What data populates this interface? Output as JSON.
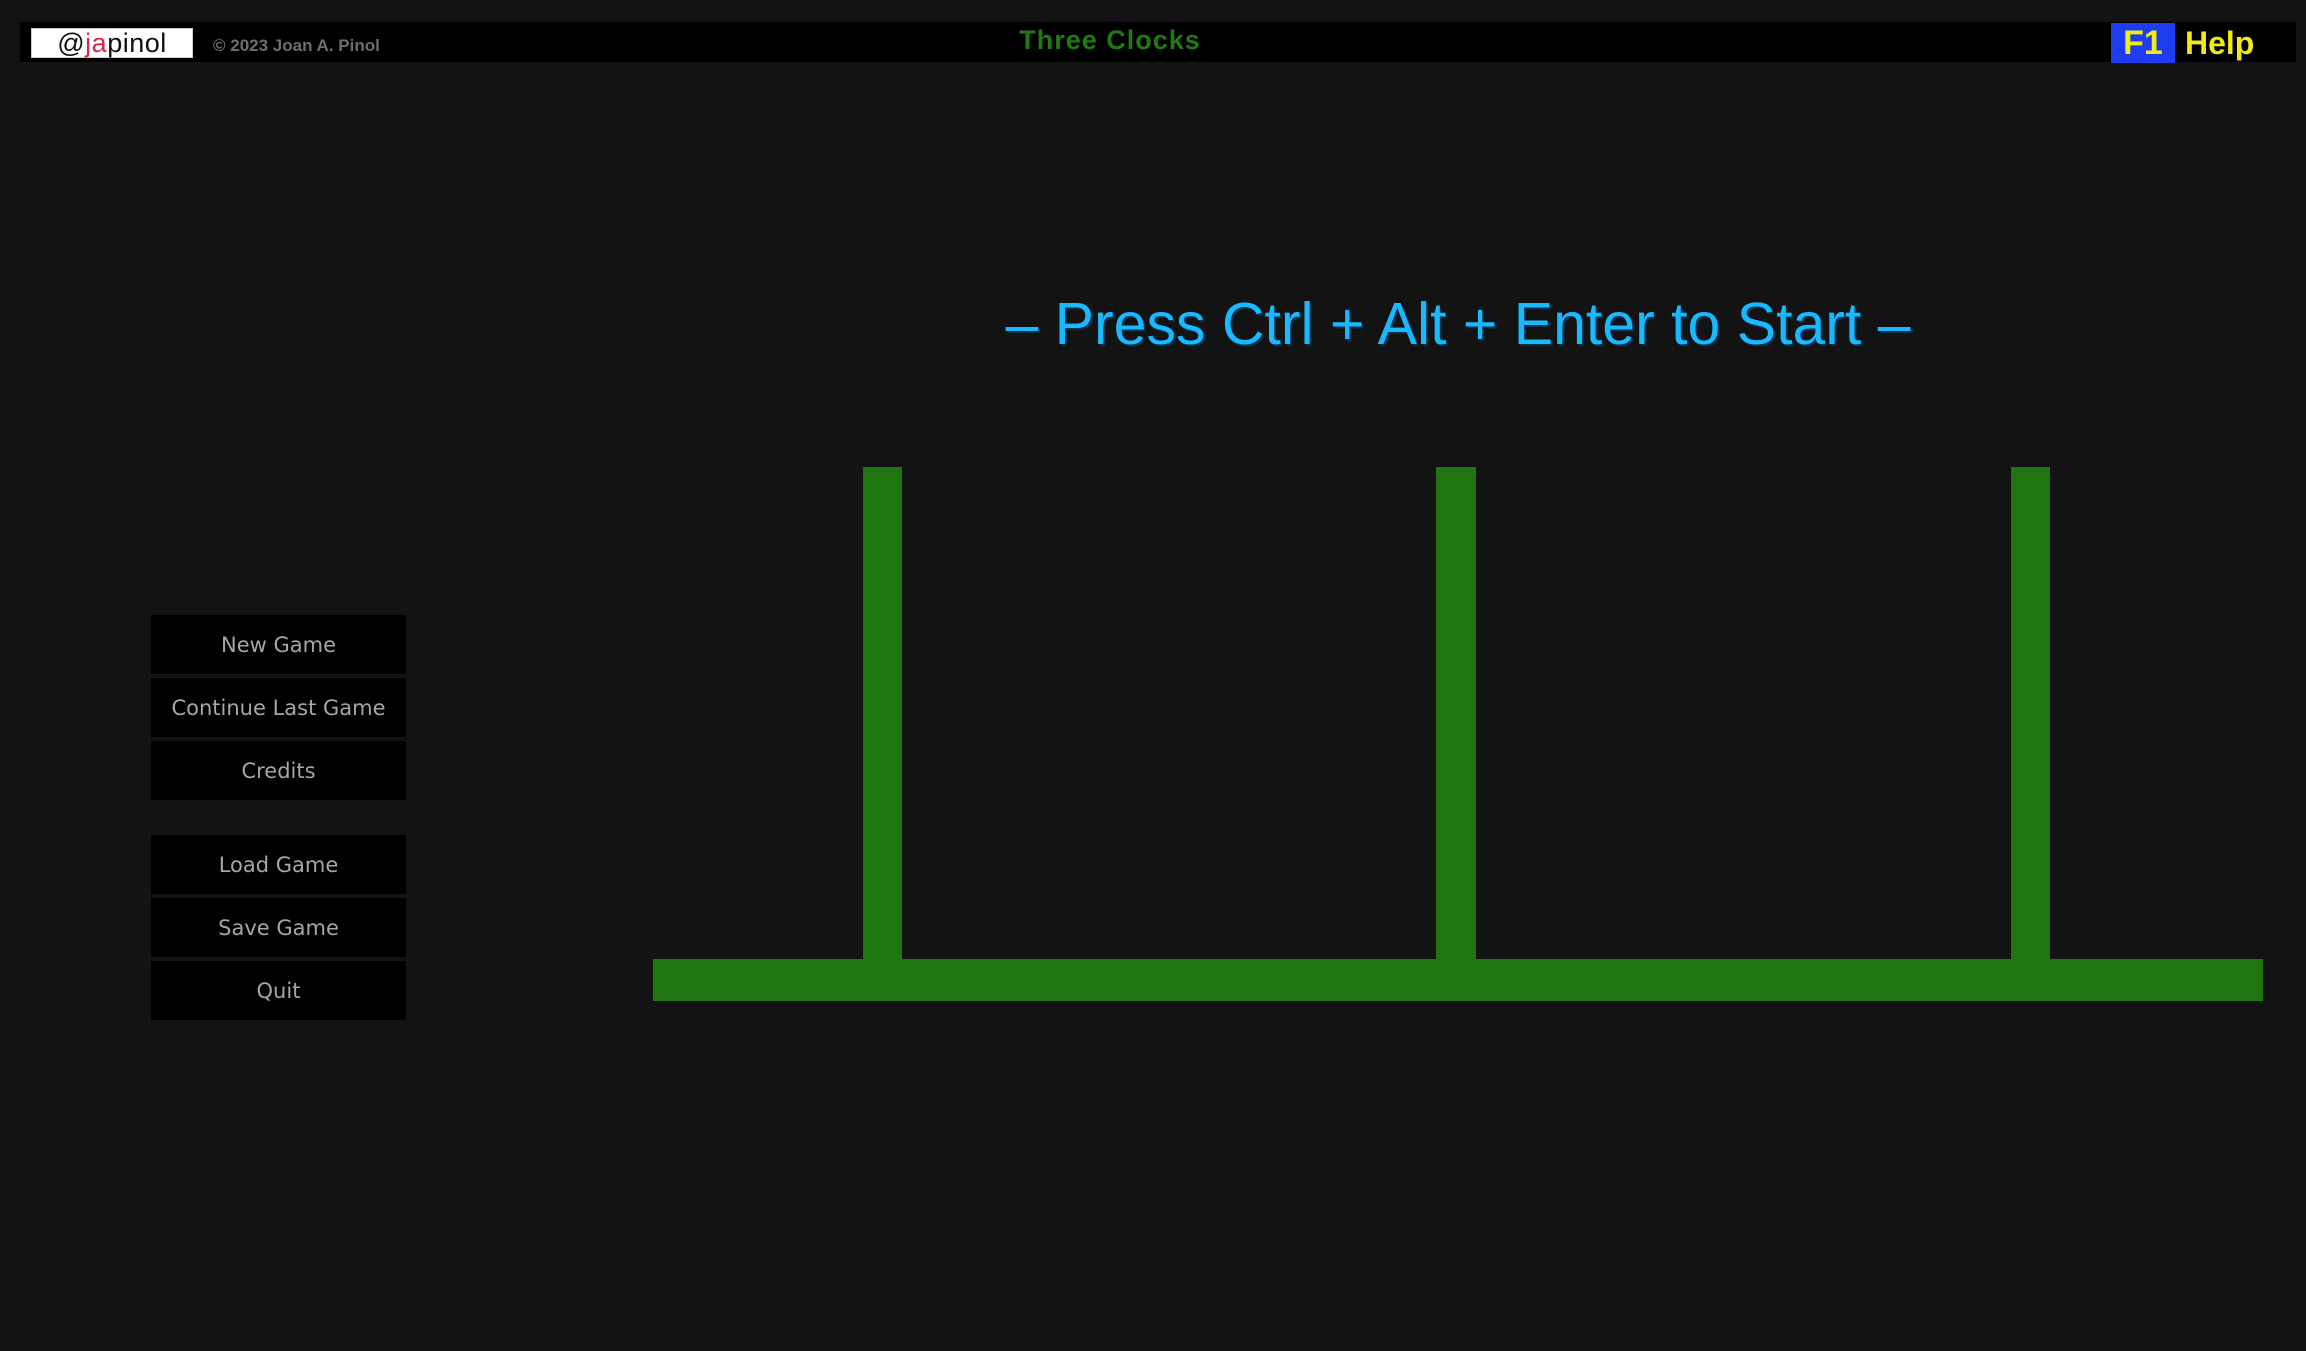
{
  "header": {
    "logo_prefix": "@",
    "logo_highlight": "ja",
    "logo_suffix": "pinol",
    "copyright": "© 2023 Joan A. Pinol",
    "title": "Three Clocks",
    "help_key": "F1",
    "help_label": "Help"
  },
  "prompt": "– Press Ctrl + Alt + Enter to Start –",
  "menu_primary": {
    "new_game": "New Game",
    "continue_last_game": "Continue Last Game",
    "credits": "Credits"
  },
  "menu_secondary": {
    "load_game": "Load Game",
    "save_game": "Save Game",
    "quit": "Quit"
  },
  "board": {
    "peg_count": 3,
    "color": "#1f7510",
    "icon": "tower-pegs-board"
  },
  "colors": {
    "background": "#131313",
    "title": "#1f7a12",
    "prompt": "#18b9ff",
    "help_key_bg": "#1e3cf0",
    "help_text": "#f2ea13",
    "menu_text": "#a6a6a6"
  }
}
